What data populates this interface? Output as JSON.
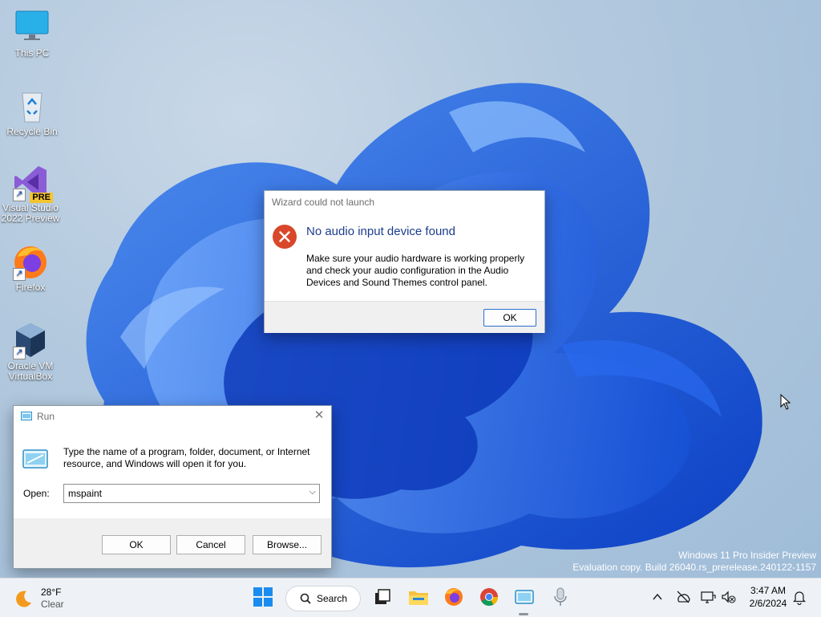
{
  "desktop": {
    "icons": [
      {
        "label": "This PC",
        "icon": "monitor-icon"
      },
      {
        "label": "Recycle Bin",
        "icon": "recycle-bin-icon"
      },
      {
        "label": "Visual Studio 2022 Preview",
        "icon": "visual-studio-icon",
        "badge": "PRE"
      },
      {
        "label": "Firefox",
        "icon": "firefox-icon"
      },
      {
        "label": "Oracle VM VirtualBox",
        "icon": "virtualbox-icon"
      }
    ],
    "watermark_line1": "Windows 11 Pro Insider Preview",
    "watermark_line2": "Evaluation copy. Build 26040.rs_prerelease.240122-1157"
  },
  "error_dialog": {
    "title": "Wizard could not launch",
    "heading": "No audio input device found",
    "message": "Make sure your audio hardware is working properly and check your audio configuration in the Audio Devices and Sound Themes control panel.",
    "ok_label": "OK",
    "icon": "error-icon"
  },
  "run_dialog": {
    "title": "Run",
    "description": "Type the name of a program, folder, document, or Internet resource, and Windows will open it for you.",
    "open_label": "Open:",
    "input_value": "mspaint",
    "ok_label": "OK",
    "cancel_label": "Cancel",
    "browse_label": "Browse..."
  },
  "taskbar": {
    "weather": {
      "temp": "28°F",
      "condition": "Clear",
      "icon": "weather-sun-icon"
    },
    "search_label": "Search",
    "pinned": [
      "start-icon",
      "task-view-icon",
      "file-explorer-icon",
      "firefox-icon",
      "chrome-icon",
      "run-icon",
      "voice-access-icon"
    ],
    "tray": [
      "chevron-up-icon",
      "network-off-icon",
      "display-icon",
      "volume-muted-icon",
      "notifications-icon"
    ],
    "time": "3:47 AM",
    "date": "2/6/2024"
  },
  "colors": {
    "accent": "#0067c0",
    "error_red": "#d9472b",
    "heading_blue": "#1d3d8f"
  }
}
